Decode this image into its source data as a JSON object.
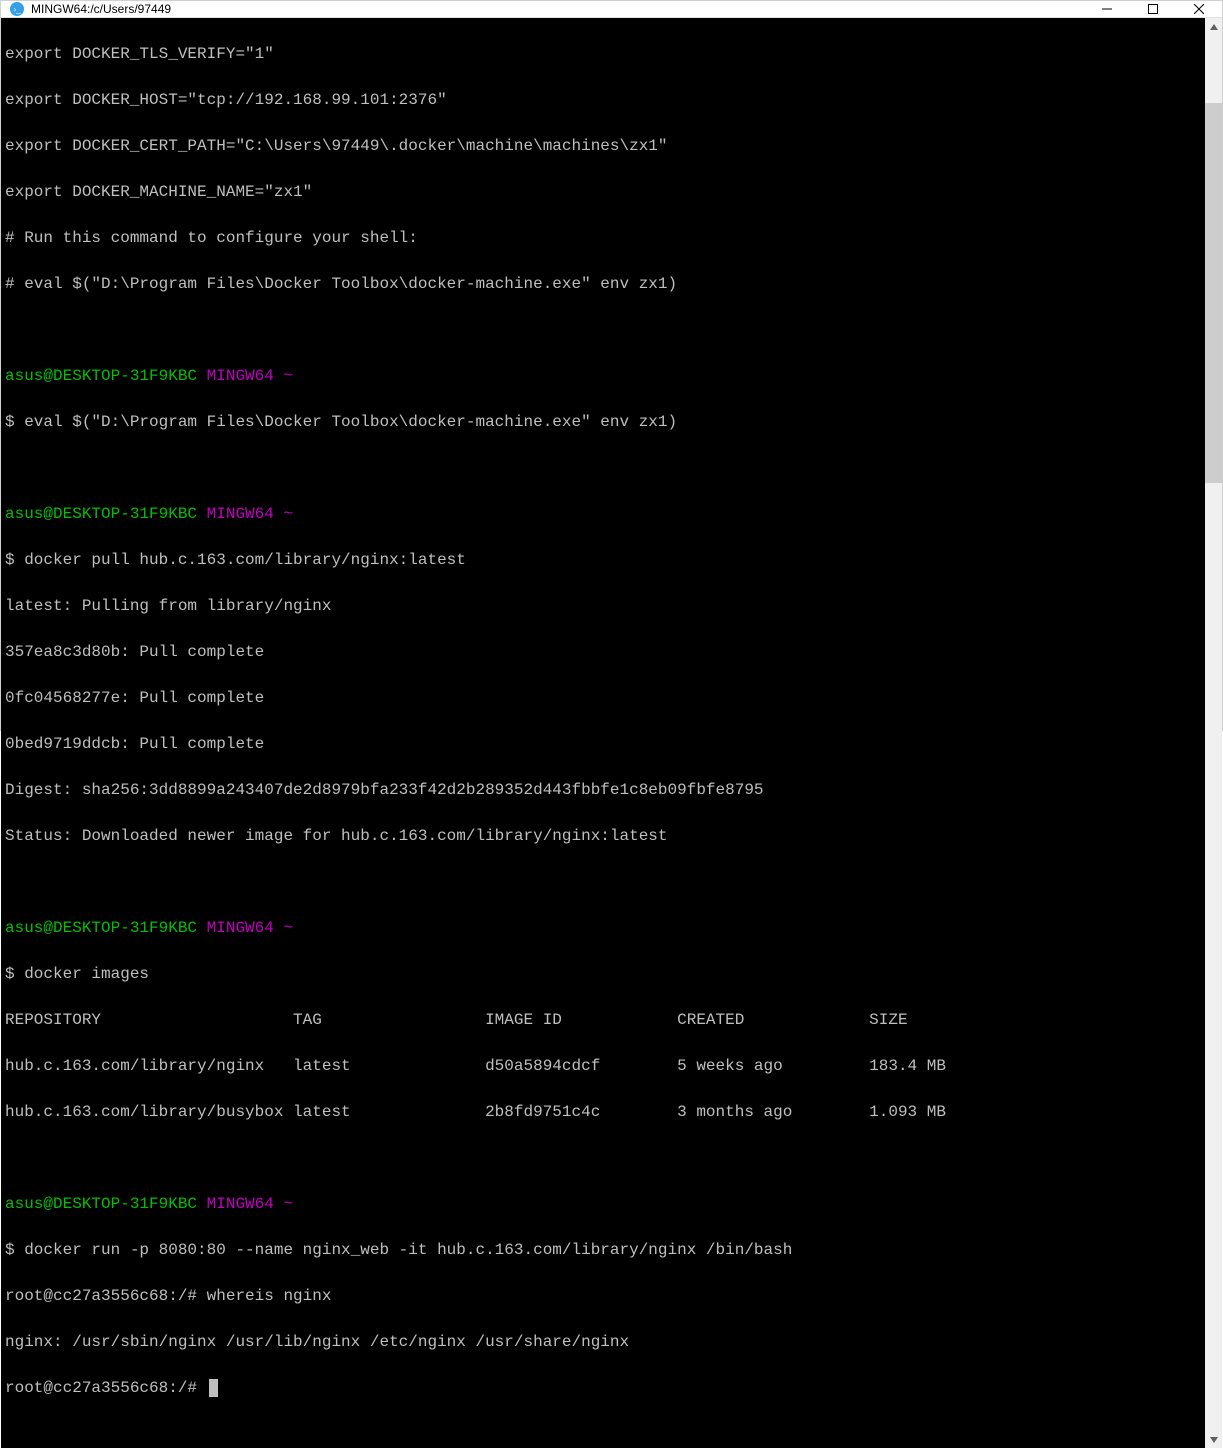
{
  "window": {
    "title": "MINGW64:/c/Users/97449"
  },
  "term": {
    "l0": "export DOCKER_TLS_VERIFY=\"1\"",
    "l1": "export DOCKER_HOST=\"tcp://192.168.99.101:2376\"",
    "l2": "export DOCKER_CERT_PATH=\"C:\\Users\\97449\\.docker\\machine\\machines\\zx1\"",
    "l3": "export DOCKER_MACHINE_NAME=\"zx1\"",
    "l4": "# Run this command to configure your shell:",
    "l5": "# eval $(\"D:\\Program Files\\Docker Toolbox\\docker-machine.exe\" env zx1)",
    "p1_user": "asus@DESKTOP-31F9KBC",
    "p1_env": "MINGW64",
    "p1_tilde": "~",
    "cmd1": "$ eval $(\"D:\\Program Files\\Docker Toolbox\\docker-machine.exe\" env zx1)",
    "cmd2": "$ docker pull hub.c.163.com/library/nginx:latest",
    "pull_l0": "latest: Pulling from library/nginx",
    "pull_l1": "357ea8c3d80b: Pull complete",
    "pull_l2": "0fc04568277e: Pull complete",
    "pull_l3": "0bed9719ddcb: Pull complete",
    "pull_l4": "Digest: sha256:3dd8899a243407de2d8979bfa233f42d2b289352d443fbbfe1c8eb09fbfe8795",
    "pull_l5": "Status: Downloaded newer image for hub.c.163.com/library/nginx:latest",
    "cmd3": "$ docker images",
    "hdr": "REPOSITORY                    TAG                 IMAGE ID            CREATED             SIZE",
    "row1": "hub.c.163.com/library/nginx   latest              d50a5894cdcf        5 weeks ago         183.4 MB",
    "row2": "hub.c.163.com/library/busybox latest              2b8fd9751c4c        3 months ago        1.093 MB",
    "cmd4": "$ docker run -p 8080:80 --name nginx_web -it hub.c.163.com/library/nginx /bin/bash",
    "root1": "root@cc27a3556c68:/# whereis nginx",
    "whereis": "nginx: /usr/sbin/nginx /usr/lib/nginx /etc/nginx /usr/share/nginx",
    "root2": "root@cc27a3556c68:/# "
  }
}
